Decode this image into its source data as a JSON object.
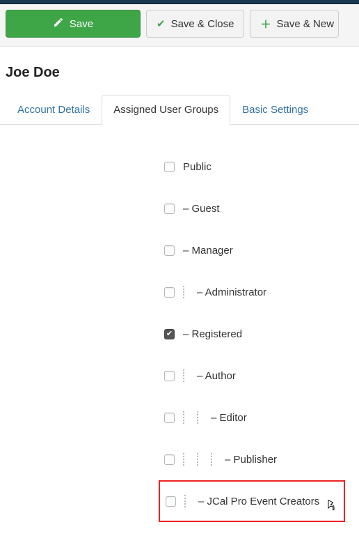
{
  "toolbar": {
    "save": "Save",
    "save_close": "Save & Close",
    "save_new": "Save & New"
  },
  "page_title": "Joe Doe",
  "tabs": {
    "account": "Account Details",
    "assigned": "Assigned User Groups",
    "basic": "Basic Settings"
  },
  "groups": [
    {
      "label": "Public",
      "depth": 0,
      "checked": false
    },
    {
      "label": "– Guest",
      "depth": 0,
      "checked": false
    },
    {
      "label": "– Manager",
      "depth": 0,
      "checked": false
    },
    {
      "label": "– Administrator",
      "depth": 1,
      "checked": false
    },
    {
      "label": "– Registered",
      "depth": 0,
      "checked": true
    },
    {
      "label": "– Author",
      "depth": 1,
      "checked": false
    },
    {
      "label": "– Editor",
      "depth": 2,
      "checked": false
    },
    {
      "label": "– Publisher",
      "depth": 3,
      "checked": false
    },
    {
      "label": "– JCal Pro Event Creators",
      "depth": 1,
      "checked": false,
      "highlight": true,
      "cursor": true
    }
  ]
}
